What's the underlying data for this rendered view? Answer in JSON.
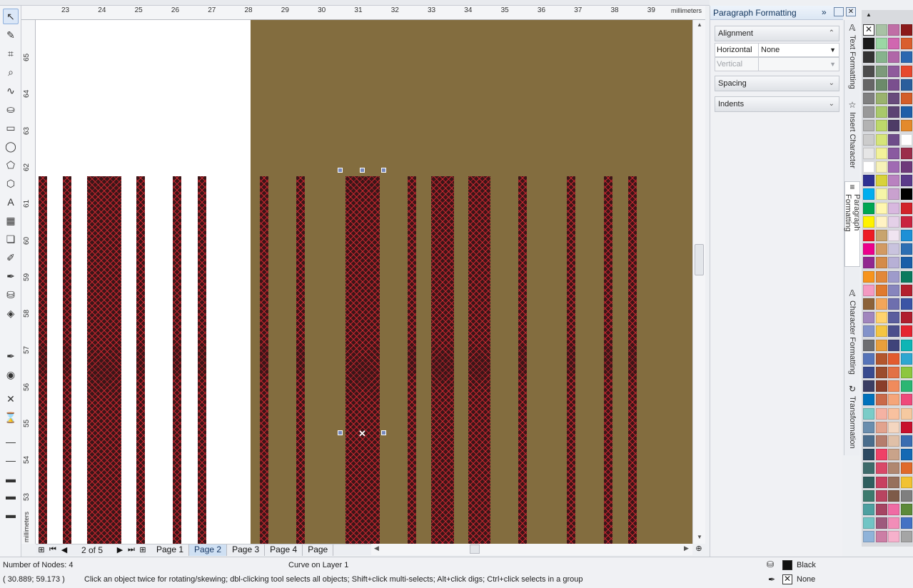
{
  "ruler": {
    "unit": "millimeters",
    "h_ticks": [
      "23",
      "24",
      "25",
      "26",
      "27",
      "28",
      "29",
      "30",
      "31",
      "32",
      "33",
      "34",
      "35",
      "36",
      "37",
      "38",
      "39"
    ],
    "v_ticks": [
      "65",
      "64",
      "63",
      "62",
      "61",
      "60",
      "59",
      "58",
      "57",
      "56",
      "55",
      "54",
      "53"
    ]
  },
  "pages": {
    "counter": "2 of 5",
    "tabs": [
      {
        "label": "Page 1",
        "active": false
      },
      {
        "label": "Page 2",
        "active": true
      },
      {
        "label": "Page 3",
        "active": false
      },
      {
        "label": "Page 4",
        "active": false
      },
      {
        "label": "Page",
        "active": false
      }
    ]
  },
  "docker": {
    "title": "Paragraph Formatting",
    "alignment_label": "Alignment",
    "horizontal_label": "Horizontal",
    "horizontal_value": "None",
    "vertical_label": "Vertical",
    "vertical_value": "",
    "spacing_label": "Spacing",
    "indents_label": "Indents"
  },
  "side_tabs": [
    "Text Formatting",
    "Insert Character",
    "Paragraph Formatting",
    "Character Formatting",
    "Transformation"
  ],
  "colors": {
    "page_bg": "#ffffff",
    "brown_fill": "#836d3f",
    "stripe_fill": "#3b1618",
    "hatch": "#dc2832",
    "accent": "#cfe0f3"
  },
  "status": {
    "nodes": "Number of Nodes: 4",
    "object": "Curve on Layer 1",
    "coords": "( 30.889; 59.173 )",
    "hint": "Click an object twice for rotating/skewing; dbl-clicking tool selects all objects; Shift+click multi-selects; Alt+click digs; Ctrl+click selects in a group",
    "fill_label": "Black",
    "outline_label": "None"
  },
  "tools": [
    "pick-tool-icon",
    "shape-tool-icon",
    "crop-tool-icon",
    "zoom-tool-icon",
    "freehand-tool-icon",
    "smart-fill-icon",
    "rectangle-tool-icon",
    "ellipse-tool-icon",
    "polygon-tool-icon",
    "basic-shapes-icon",
    "text-tool-icon",
    "table-tool-icon",
    "blend-tool-icon",
    "eyedropper-icon",
    "outline-pen-icon",
    "fill-tool-icon",
    "interactive-fill-icon",
    "pen-outline-icon",
    "color-wheel-icon",
    "no-outline-icon",
    "hairline-icon",
    "line-weight-1-icon",
    "line-weight-2-icon",
    "line-weight-3-icon",
    "line-weight-4-icon",
    "line-weight-5-icon"
  ],
  "palette_columns": [
    [
      "#c5cfd8",
      "#1a1a1a",
      "#333333",
      "#4d4d4d",
      "#666666",
      "#808080",
      "#999999",
      "#b3b3b3",
      "#cccccc",
      "#e6e6e6",
      "#ffffff",
      "#2e3192",
      "#00aeef",
      "#00a651",
      "#fff200",
      "#ed1c24",
      "#ec008c",
      "#92278f",
      "#f7941d",
      "#f49ac2",
      "#8c6239",
      "#a186be",
      "#8393ca",
      "#6d6e71",
      "#5674b9",
      "#394b8f",
      "#3b3e63",
      "#0072bc",
      "#7accc8",
      "#6a8eae",
      "#4a6d8c",
      "#2e4a62",
      "#3e6b6b",
      "#2f5e5e",
      "#3d7a6d",
      "#4da0a0",
      "#71c5c5",
      "#8fb3d9"
    ],
    [
      "#a8c2a5",
      "#9bd6a4",
      "#86b38c",
      "#7d9a7b",
      "#6c8a6a",
      "#9ab36e",
      "#a9c96b",
      "#bdd96b",
      "#d6e57a",
      "#f2f29a",
      "#f7f2b8",
      "#d8d23a",
      "#f5f5a8",
      "#fff7b0",
      "#fff3c4",
      "#c8a46e",
      "#d29a63",
      "#d48b4a",
      "#e2883a",
      "#e07a2f",
      "#f2a65a",
      "#ffd36e",
      "#f4c542",
      "#ea9f3c",
      "#b3562d",
      "#9b4d2e",
      "#8a3e2a",
      "#c96a4a",
      "#f5b2a3",
      "#e2a38e",
      "#b57d6d",
      "#ef4167",
      "#d94868",
      "#c84060",
      "#b84460",
      "#a64563",
      "#9e5a7d",
      "#cc7ea5"
    ],
    [
      "#c06ea6",
      "#d067b0",
      "#b066a8",
      "#8f5a9c",
      "#7a4f8e",
      "#684a7c",
      "#5c4373",
      "#4e3c66",
      "#6e4c8a",
      "#8a5aa0",
      "#a06ab3",
      "#b982c0",
      "#c9a1cf",
      "#d8b8df",
      "#e4d0e8",
      "#f0e4f1",
      "#c9c3de",
      "#b7b0d6",
      "#9e9bcb",
      "#8785bd",
      "#6e6fae",
      "#5a5e9e",
      "#4b4f8c",
      "#3f437a",
      "#e35b2e",
      "#e27145",
      "#f08b5c",
      "#f5a57a",
      "#f9c19f",
      "#f4d6c0",
      "#e0c0a8",
      "#c9a38a",
      "#b08770",
      "#97705c",
      "#7e5b49",
      "#f06ba4",
      "#f28db8",
      "#f6b1cc"
    ],
    [
      "#8b1a1a",
      "#d95f2e",
      "#2c68b0",
      "#e6492d",
      "#2a5e9c",
      "#d35e2a",
      "#1f5fa8",
      "#e38a2c",
      "#ffffff",
      "#9b2e4a",
      "#6e3a7a",
      "#5b3b8a",
      "#000000",
      "#d2232a",
      "#c9243f",
      "#1e90d6",
      "#2d6fb3",
      "#1a5ea8",
      "#0b7a5e",
      "#b3202f",
      "#3b54a5",
      "#b01f2e",
      "#e5242f",
      "#0fb5b5",
      "#2fa7d1",
      "#8dc63f",
      "#2bb673",
      "#ef4a7b",
      "#f5c9a0",
      "#c8102e",
      "#3a6db1",
      "#1469b4",
      "#e06a2a",
      "#f1c232",
      "#7f7f7f",
      "#5c8a3a",
      "#4472c4",
      "#a5a5a5"
    ]
  ]
}
